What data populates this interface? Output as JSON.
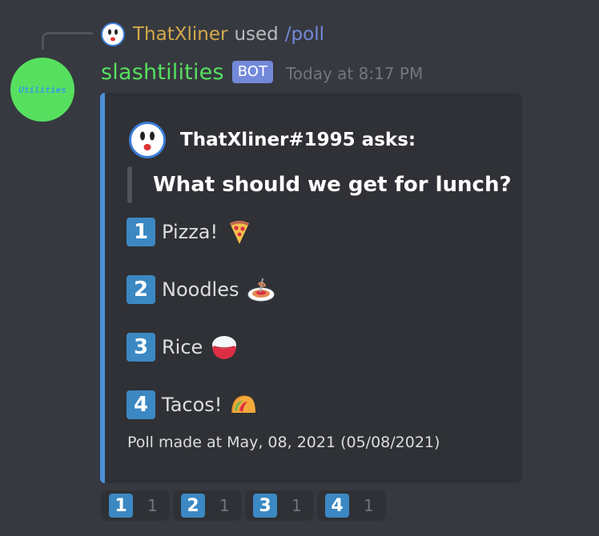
{
  "reply": {
    "username": "ThatXliner",
    "used_text": "used",
    "command": "/poll"
  },
  "message": {
    "bot_name": "slashtilities",
    "bot_avatar_text": "Utilities",
    "bot_tag": "BOT",
    "timestamp": "Today at 8:17 PM"
  },
  "embed": {
    "accent_color": "#4a90d9",
    "author": "ThatXliner#1995 asks:",
    "question": "What should we get for lunch?",
    "options": [
      {
        "number": "1",
        "text": "Pizza!",
        "emoji": "pizza-icon"
      },
      {
        "number": "2",
        "text": "Noodles",
        "emoji": "spaghetti-icon"
      },
      {
        "number": "3",
        "text": "Rice",
        "emoji": "rice-bowl-icon"
      },
      {
        "number": "4",
        "text": "Tacos!",
        "emoji": "taco-icon"
      }
    ],
    "footer": "Poll made at May, 08, 2021 (05/08/2021)"
  },
  "reactions": [
    {
      "emoji": "1",
      "count": "1"
    },
    {
      "emoji": "2",
      "count": "1"
    },
    {
      "emoji": "3",
      "count": "1"
    },
    {
      "emoji": "4",
      "count": "1"
    }
  ],
  "colors": {
    "background": "#36393f",
    "embed_bg": "#2f3136",
    "bot_name": "#57e05f",
    "reply_user": "#d4a94a",
    "command": "#7289da",
    "keycap": "#3b88c3"
  }
}
